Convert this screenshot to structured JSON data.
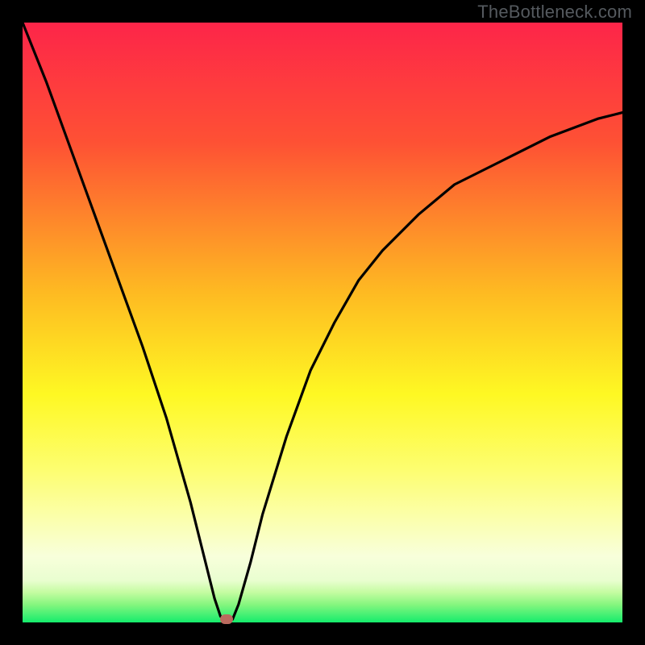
{
  "source_label": "TheBottleneck.com",
  "chart_data": {
    "type": "line",
    "title": "",
    "xlabel": "",
    "ylabel": "",
    "xlim": [
      0,
      100
    ],
    "ylim": [
      0,
      100
    ],
    "min_marker": {
      "x": 34,
      "y": 0.5
    },
    "series": [
      {
        "name": "bottleneck-curve",
        "x": [
          0,
          4,
          8,
          12,
          16,
          20,
          24,
          28,
          30,
          31,
          32,
          33,
          34,
          35,
          36,
          38,
          40,
          44,
          48,
          52,
          56,
          60,
          66,
          72,
          80,
          88,
          96,
          100
        ],
        "values": [
          100,
          90,
          79,
          68,
          57,
          46,
          34,
          20,
          12,
          8,
          4,
          1,
          0.5,
          0.5,
          3,
          10,
          18,
          31,
          42,
          50,
          57,
          62,
          68,
          73,
          77,
          81,
          84,
          85
        ]
      }
    ],
    "gradient_stops": [
      {
        "pct": 0,
        "color": "#fd2549"
      },
      {
        "pct": 20,
        "color": "#fe5134"
      },
      {
        "pct": 45,
        "color": "#feba22"
      },
      {
        "pct": 62,
        "color": "#fef823"
      },
      {
        "pct": 75,
        "color": "#fdfe73"
      },
      {
        "pct": 83,
        "color": "#fbffaf"
      },
      {
        "pct": 89,
        "color": "#f8ffdb"
      },
      {
        "pct": 93,
        "color": "#e9fed0"
      },
      {
        "pct": 95,
        "color": "#c4fca1"
      },
      {
        "pct": 97,
        "color": "#86f67f"
      },
      {
        "pct": 100,
        "color": "#15ec6c"
      }
    ],
    "curve_color": "#000000",
    "min_marker_color": "#bb6a5e",
    "frame_color": "#000000"
  }
}
